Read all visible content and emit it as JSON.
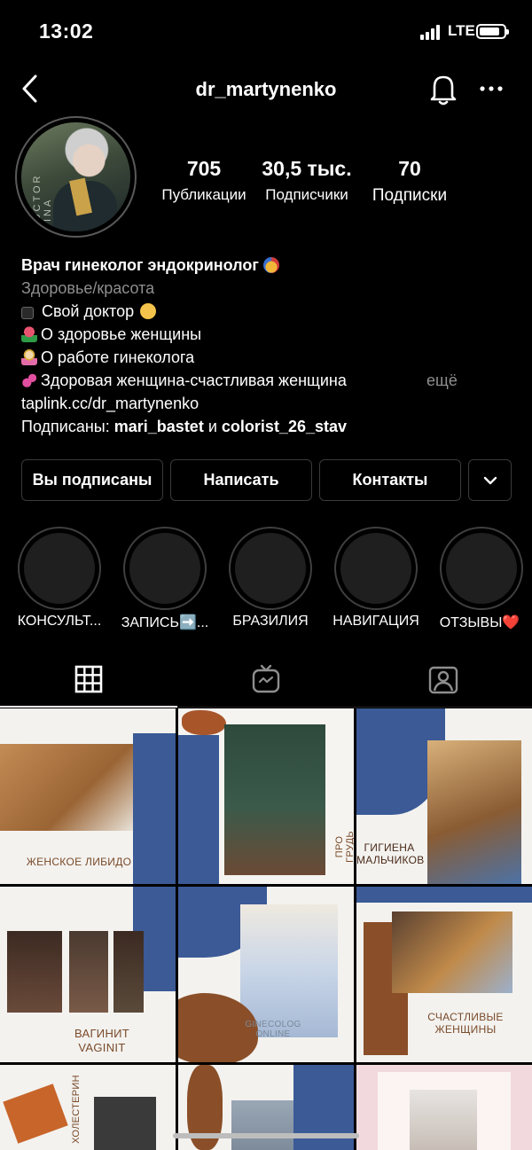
{
  "status_bar": {
    "time": "13:02",
    "network": "LTE"
  },
  "header": {
    "username": "dr_martynenko"
  },
  "stats": [
    {
      "value": "705",
      "label": "Публикации"
    },
    {
      "value": "30,5 тыс.",
      "label": "Подписчики"
    },
    {
      "value": "70",
      "label": "Подписки"
    }
  ],
  "bio": {
    "name": "Врач гинеколог эндокринолог",
    "category": "Здоровье/красота",
    "lines": [
      {
        "emoji": "black-square",
        "text": "Свой доктор"
      },
      {
        "emoji": "tulip",
        "text": "О здоровье женщины"
      },
      {
        "emoji": "woman-tipping-hand",
        "text": "О работе гинеколога"
      },
      {
        "emoji": "two-hearts",
        "text": "Здоровая женщина-счастливая женщина"
      }
    ],
    "more": "ещё",
    "link": "taplink.cc/dr_martynenko",
    "followed_by_prefix": "Подписаны:",
    "followed_by_user1": "mari_bastet",
    "followed_by_joiner": "и",
    "followed_by_user2": "colorist_26_stav"
  },
  "buttons": {
    "following": "Вы подписаны",
    "message": "Написать",
    "contacts": "Контакты"
  },
  "highlights": [
    {
      "label": "КОНСУЛЬТ..."
    },
    {
      "label": "ЗАПИСЬ➡️..."
    },
    {
      "label": "БРАЗИЛИЯ"
    },
    {
      "label": "НАВИГАЦИЯ"
    },
    {
      "label": "ОТЗЫВЫ❤️"
    }
  ],
  "tabs": [
    "grid",
    "igtv",
    "tagged"
  ],
  "posts": [
    {
      "caption": "ЖЕНСКОЕ ЛИБИДО"
    },
    {
      "caption": "ПРО ГРУДЬ"
    },
    {
      "caption": "ГИГИЕНА МАЛЬЧИКОВ"
    },
    {
      "caption": "ВАГИНИТ VAGINIT"
    },
    {
      "caption": "GINECOLOG ONLINE"
    },
    {
      "caption": "СЧАСТЛИВЫЕ ЖЕНЩИНЫ"
    },
    {
      "caption": "ХОЛЕСТЕРИН"
    },
    {
      "caption": ""
    },
    {
      "caption": ""
    }
  ],
  "colors": {
    "background": "#000000",
    "text": "#ffffff",
    "muted": "#8e8e8e",
    "accent_blue": "#3b5a96",
    "accent_brown": "#8a4f28"
  }
}
